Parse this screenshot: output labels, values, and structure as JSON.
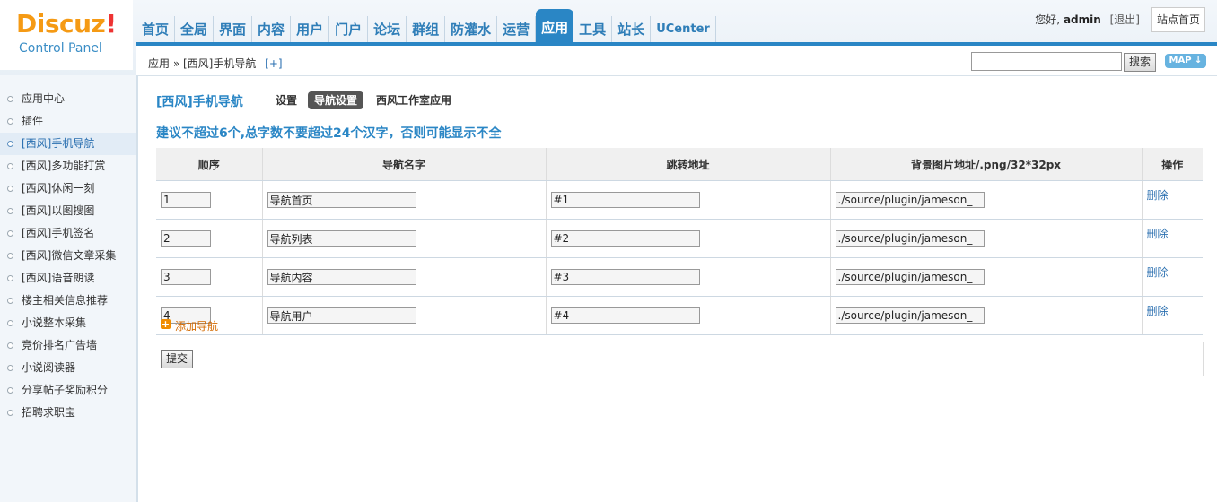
{
  "header": {
    "logo_text": "Discuz",
    "logo_bang": "!",
    "logo_sub": "Control Panel",
    "nav": [
      "首页",
      "全局",
      "界面",
      "内容",
      "用户",
      "门户",
      "论坛",
      "群组",
      "防灌水",
      "运营",
      "应用",
      "工具",
      "站长",
      "UCenter"
    ],
    "active_nav": "应用",
    "greeting": "您好,",
    "username": "admin",
    "logout": "[退出]",
    "site_home": "站点首页"
  },
  "crumb": {
    "path": "应用 » [西风]手机导航",
    "plus": "[+]",
    "search_value": "",
    "search_button": "搜索",
    "map_button": "MAP ↓"
  },
  "sidebar": {
    "items": [
      "应用中心",
      "插件",
      "[西风]手机导航",
      "[西风]多功能打赏",
      "[西风]休闲一刻",
      "[西风]以图搜图",
      "[西风]手机签名",
      "[西风]微信文章采集",
      "[西风]语音朗读",
      "楼主相关信息推荐",
      "小说整本采集",
      "竞价排名广告墙",
      "小说阅读器",
      "分享帖子奖励积分",
      "招聘求职宝"
    ],
    "active_index": 2
  },
  "main": {
    "plugin_title": "[西风]手机导航",
    "tabs": {
      "settings": "设置",
      "nav_settings": "导航设置",
      "studio": "西风工作室应用"
    },
    "tip": "建议不超过6个,总字数不要超过24个汉字，否则可能显示不全",
    "table": {
      "headers": [
        "顺序",
        "导航名字",
        "跳转地址",
        "背景图片地址/.png/32*32px",
        "操作"
      ],
      "rows": [
        {
          "order": "1",
          "name": "导航首页",
          "url": "#1",
          "bg": "./source/plugin/jameson_",
          "action": "删除"
        },
        {
          "order": "2",
          "name": "导航列表",
          "url": "#2",
          "bg": "./source/plugin/jameson_",
          "action": "删除"
        },
        {
          "order": "3",
          "name": "导航内容",
          "url": "#3",
          "bg": "./source/plugin/jameson_",
          "action": "删除"
        },
        {
          "order": "4",
          "name": "导航用户",
          "url": "#4",
          "bg": "./source/plugin/jameson_",
          "action": "删除"
        }
      ]
    },
    "add_icon": "+",
    "add_label": "添加导航",
    "submit_label": "提交"
  }
}
